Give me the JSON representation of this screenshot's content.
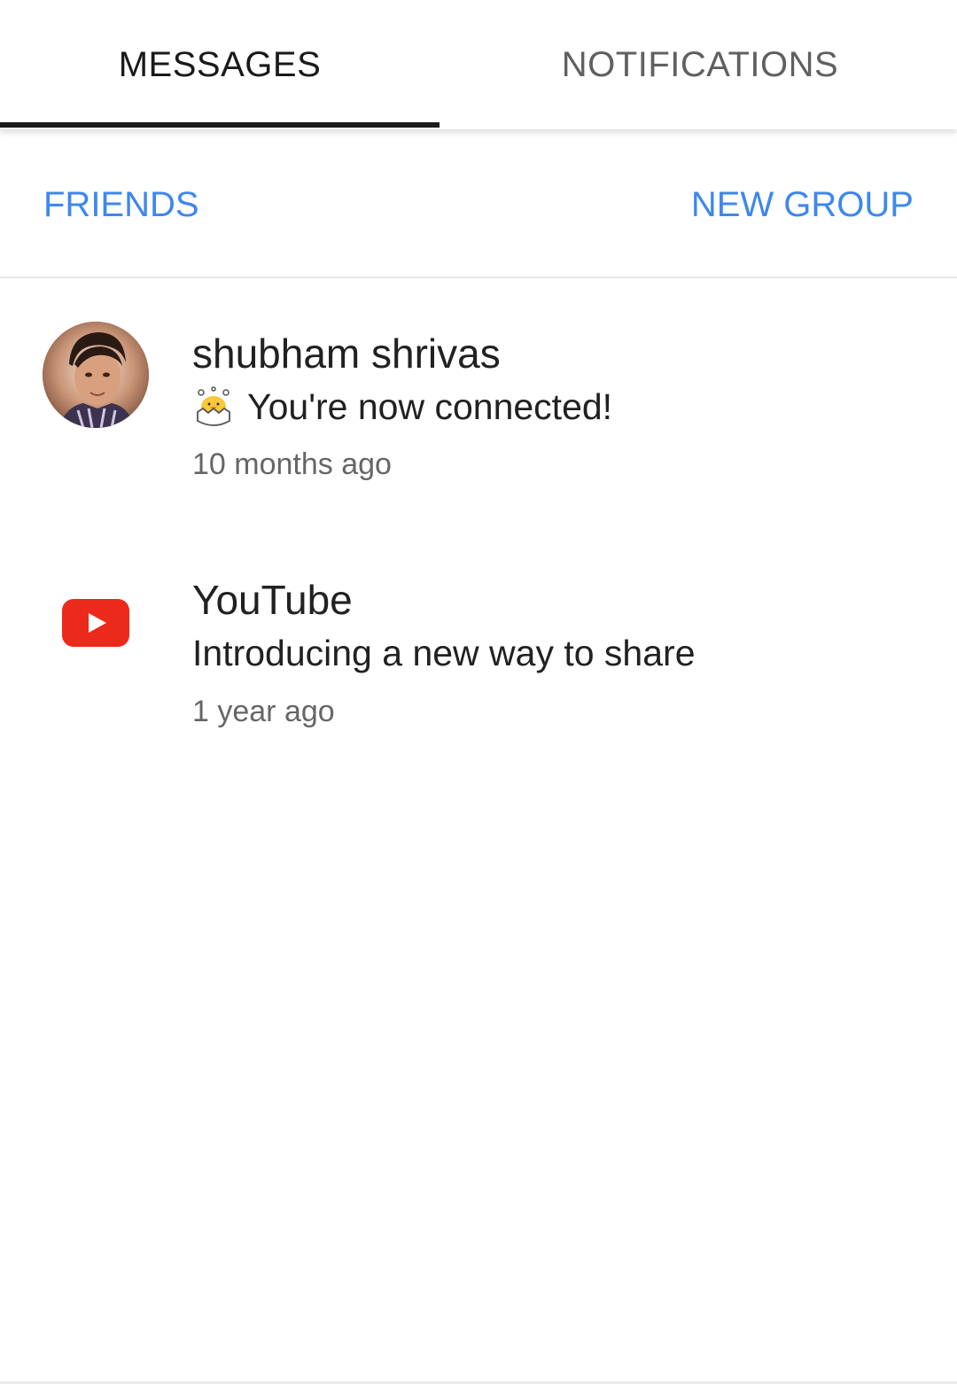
{
  "tabs": {
    "messages": "MESSAGES",
    "notifications": "NOTIFICATIONS",
    "active": "messages"
  },
  "actions": {
    "friends": "FRIENDS",
    "new_group": "NEW GROUP"
  },
  "conversations": [
    {
      "name": "shubham shrivas",
      "avatar": "user-avatar-photo",
      "preview_icon": "hatching-chick-icon",
      "preview": "You're now connected!",
      "time": "10 months ago"
    },
    {
      "name": "YouTube",
      "avatar": "youtube-logo-icon",
      "preview": "Introducing a new way to share",
      "time": "1 year ago"
    }
  ],
  "colors": {
    "accent": "#3f87ec",
    "youtube_red": "#ec2a1b",
    "tab_active": "#1a1a1a",
    "tab_inactive": "#606060"
  }
}
